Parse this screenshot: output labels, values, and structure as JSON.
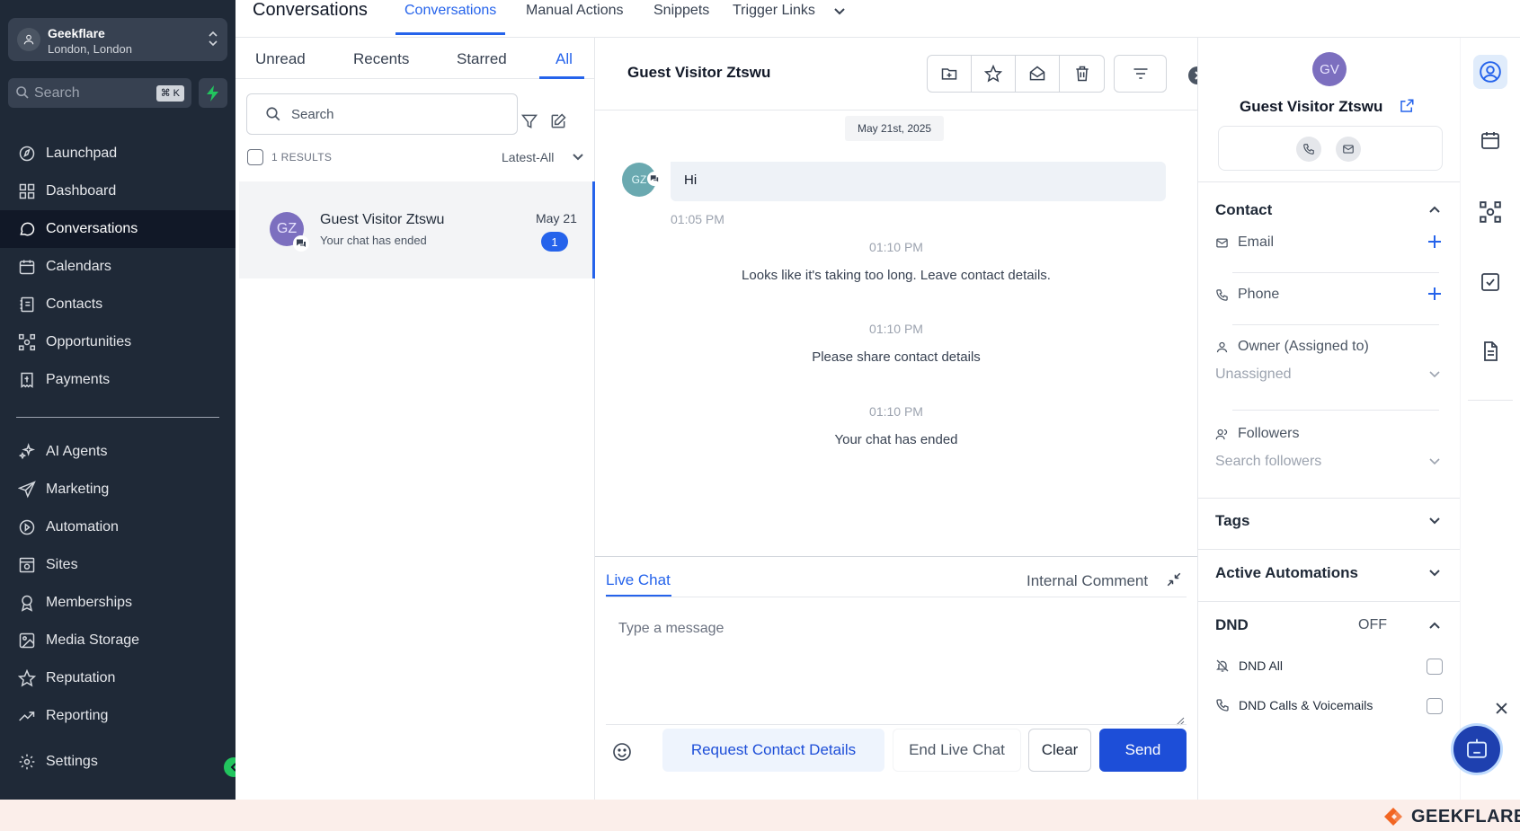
{
  "colors": {
    "primary": "#2563eb",
    "sidebar_bg": "#1f2937",
    "accent_green": "#22c55e",
    "avatar_purple": "#7c6fbf",
    "footer_bg": "#fbeeea"
  },
  "sidebar": {
    "account": {
      "name": "Geekflare",
      "location": "London, London"
    },
    "search": {
      "placeholder": "Search",
      "shortcut": "⌘ K"
    },
    "items": [
      {
        "label": "Launchpad",
        "icon": "launchpad-icon"
      },
      {
        "label": "Dashboard",
        "icon": "dashboard-icon"
      },
      {
        "label": "Conversations",
        "icon": "chat-icon",
        "active": true
      },
      {
        "label": "Calendars",
        "icon": "calendar-icon"
      },
      {
        "label": "Contacts",
        "icon": "contacts-icon"
      },
      {
        "label": "Opportunities",
        "icon": "opportunities-icon"
      },
      {
        "label": "Payments",
        "icon": "payments-icon"
      }
    ],
    "items2": [
      {
        "label": "AI Agents",
        "icon": "sparkle-icon"
      },
      {
        "label": "Marketing",
        "icon": "send-icon"
      },
      {
        "label": "Automation",
        "icon": "automation-icon"
      },
      {
        "label": "Sites",
        "icon": "sites-icon"
      },
      {
        "label": "Memberships",
        "icon": "badge-icon"
      },
      {
        "label": "Media Storage",
        "icon": "image-icon"
      },
      {
        "label": "Reputation",
        "icon": "star-icon"
      },
      {
        "label": "Reporting",
        "icon": "trend-icon"
      }
    ],
    "settings": "Settings"
  },
  "topbar": {
    "title": "Conversations",
    "tabs": [
      "Conversations",
      "Manual Actions",
      "Snippets",
      "Trigger Links"
    ]
  },
  "list": {
    "tabs": [
      "Unread",
      "Recents",
      "Starred",
      "All"
    ],
    "search_placeholder": "Search",
    "results": "1 RESULTS",
    "sort": "Latest-All",
    "conversation": {
      "initials": "GZ",
      "name": "Guest Visitor Ztswu",
      "preview": "Your chat has ended",
      "date": "May 21",
      "unread": "1"
    }
  },
  "chat": {
    "title": "Guest Visitor Ztswu",
    "date_chip": "May 21st, 2025",
    "message": {
      "initials": "GZ",
      "text": "Hi",
      "time": "01:05 PM"
    },
    "system": [
      {
        "time": "01:10 PM",
        "text": "Looks like it's taking too long. Leave contact details."
      },
      {
        "time": "01:10 PM",
        "text": "Please share contact details"
      },
      {
        "time": "01:10 PM",
        "text": "Your chat has ended"
      }
    ],
    "composer": {
      "tab_live": "Live Chat",
      "tab_internal": "Internal Comment",
      "placeholder": "Type a message",
      "btn_request": "Request Contact Details",
      "btn_end": "End Live Chat",
      "btn_clear": "Clear",
      "btn_send": "Send"
    }
  },
  "contact": {
    "initials": "GV",
    "name": "Guest Visitor Ztswu",
    "section_contact": "Contact",
    "email": "Email",
    "phone": "Phone",
    "owner": "Owner (Assigned to)",
    "owner_value": "Unassigned",
    "followers": "Followers",
    "followers_placeholder": "Search followers",
    "tags": "Tags",
    "automations": "Active Automations",
    "dnd": "DND",
    "dnd_state": "OFF",
    "dnd_all": "DND All",
    "dnd_calls": "DND Calls & Voicemails"
  },
  "footer": {
    "brand": "GEEKFLARE"
  }
}
